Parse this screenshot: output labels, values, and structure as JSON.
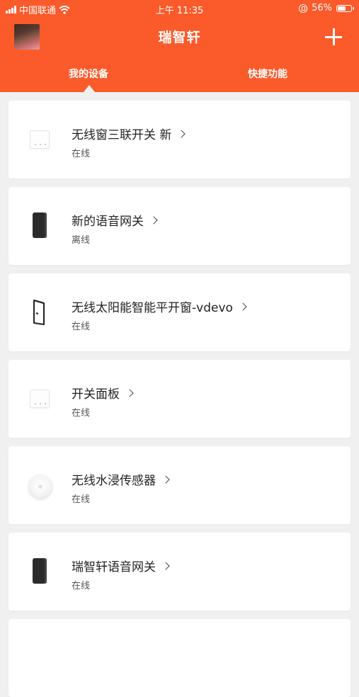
{
  "status_bar": {
    "carrier": "中国联通",
    "time": "上午 11:35",
    "battery": "56%",
    "battery_level": 0.56,
    "icons": [
      "signal-icon",
      "wifi-icon",
      "orientation-lock-icon",
      "battery-icon"
    ]
  },
  "header": {
    "title": "瑞智轩",
    "add_icon": "plus-icon",
    "background": "#fb5a2a"
  },
  "tabs": [
    {
      "label": "我的设备",
      "active": true
    },
    {
      "label": "快捷功能",
      "active": false
    }
  ],
  "devices": [
    {
      "name": "无线窗三联开关 新",
      "status": "在线",
      "icon": "switch-panel-icon"
    },
    {
      "name": "新的语音网关",
      "status": "离线",
      "icon": "gateway-icon"
    },
    {
      "name": "无线太阳能智能平开窗-vdevo",
      "status": "在线",
      "icon": "window-icon"
    },
    {
      "name": "开关面板",
      "status": "在线",
      "icon": "switch-panel-icon"
    },
    {
      "name": "无线水浸传感器",
      "status": "在线",
      "icon": "water-sensor-icon"
    },
    {
      "name": "瑞智轩语音网关",
      "status": "在线",
      "icon": "gateway-icon"
    }
  ]
}
